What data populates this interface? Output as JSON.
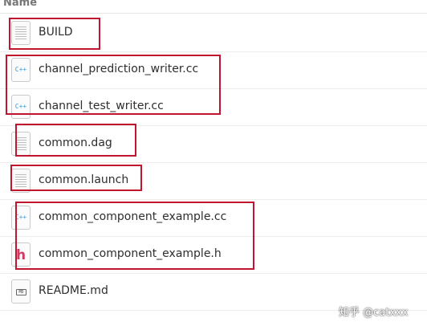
{
  "header": {
    "name_column": "Name"
  },
  "files": [
    {
      "name": "BUILD",
      "icon": "text-file-icon"
    },
    {
      "name": "channel_prediction_writer.cc",
      "icon": "cpp-file-icon",
      "icon_label": "C++"
    },
    {
      "name": "channel_test_writer.cc",
      "icon": "cpp-file-icon",
      "icon_label": "C++"
    },
    {
      "name": "common.dag",
      "icon": "text-file-icon"
    },
    {
      "name": "common.launch",
      "icon": "text-file-icon"
    },
    {
      "name": "common_component_example.cc",
      "icon": "cpp-file-icon",
      "icon_label": "C++"
    },
    {
      "name": "common_component_example.h",
      "icon": "header-file-icon",
      "icon_label": "h"
    },
    {
      "name": "README.md",
      "icon": "markdown-file-icon",
      "icon_label": "MD"
    }
  ],
  "colors": {
    "highlight": "#c0152f",
    "cpp_icon": "#3a9ad9",
    "header_icon": "#d23a64"
  },
  "watermark": "知乎 @catxxx"
}
